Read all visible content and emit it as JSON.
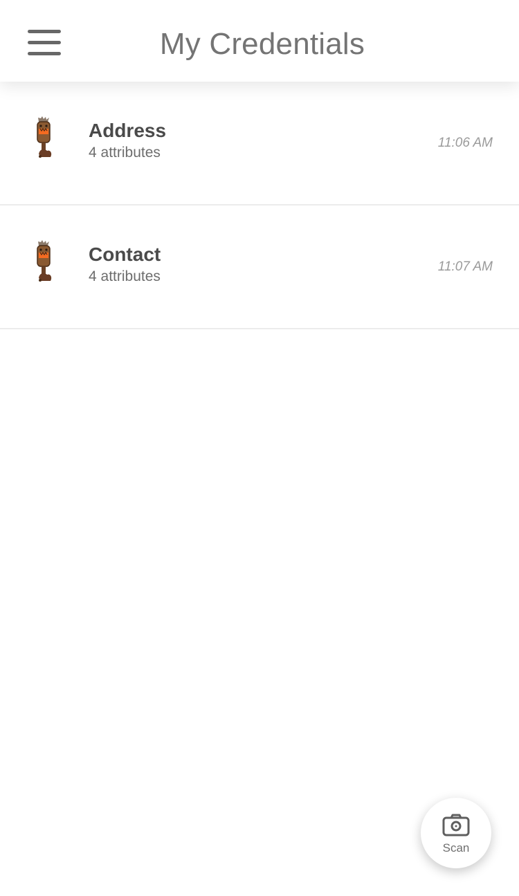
{
  "header": {
    "title": "My Credentials",
    "menu_icon": "hamburger-menu-icon"
  },
  "credentials": [
    {
      "title": "Address",
      "subtitle": "4 attributes",
      "time": "11:06 AM",
      "icon": "tiki-totem-icon"
    },
    {
      "title": "Contact",
      "subtitle": "4 attributes",
      "time": "11:07 AM",
      "icon": "tiki-totem-icon"
    }
  ],
  "scan": {
    "label": "Scan",
    "icon": "camera-icon"
  },
  "colors": {
    "header_text": "#747474",
    "title_text": "#4a4a4a",
    "subtitle_text": "#6d6d6d",
    "time_text": "#9a9a9a",
    "divider": "#ececec",
    "background": "#ffffff"
  }
}
